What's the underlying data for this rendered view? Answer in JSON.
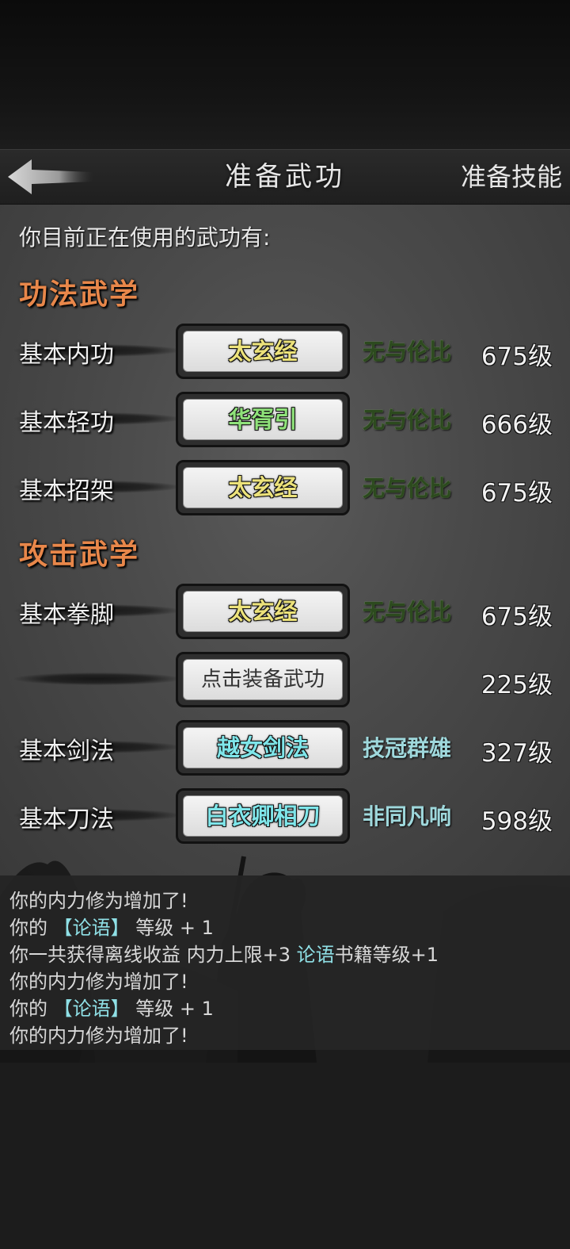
{
  "header": {
    "title": "准备武功",
    "right_label": "准备技能"
  },
  "intro": "你目前正在使用的武功有:",
  "sections": [
    {
      "title": "功法武学"
    },
    {
      "title": "攻击武学"
    }
  ],
  "slots": [
    {
      "label": "基本内功",
      "skill": "太玄经",
      "grade": "无与伦比",
      "level": "675级"
    },
    {
      "label": "基本轻功",
      "skill": "华胥引",
      "grade": "无与伦比",
      "level": "666级"
    },
    {
      "label": "基本招架",
      "skill": "太玄经",
      "grade": "无与伦比",
      "level": "675级"
    },
    {
      "label": "基本拳脚",
      "skill": "太玄经",
      "grade": "无与伦比",
      "level": "675级"
    },
    {
      "label": "",
      "skill": "点击装备武功",
      "grade": "",
      "level": "225级"
    },
    {
      "label": "基本剑法",
      "skill": "越女剑法",
      "grade": "技冠群雄",
      "level": "327级"
    },
    {
      "label": "基本刀法",
      "skill": "白衣卿相刀",
      "grade": "非同凡响",
      "level": "598级"
    }
  ],
  "log": {
    "line1": "你的内力修为增加了!",
    "line2_pre": "你的 ",
    "line2_item": "【论语】",
    "line2_post": " 等级 + 1",
    "line3_pre": "你一共获得离线收益 内力上限+3 ",
    "line3_item": "论语",
    "line3_post": "书籍等级+1",
    "line4": "你的内力修为增加了!",
    "line5_pre": "你的 ",
    "line5_item": "【论语】",
    "line5_post": " 等级 + 1",
    "line6": "你的内力修为增加了!"
  },
  "colors": {
    "section_title": "#e8874a",
    "skill_yellow": "#ece27a",
    "skill_green": "#8fe27a",
    "skill_cyan": "#7fe6ea",
    "log_highlight": "#8fe0e6"
  }
}
